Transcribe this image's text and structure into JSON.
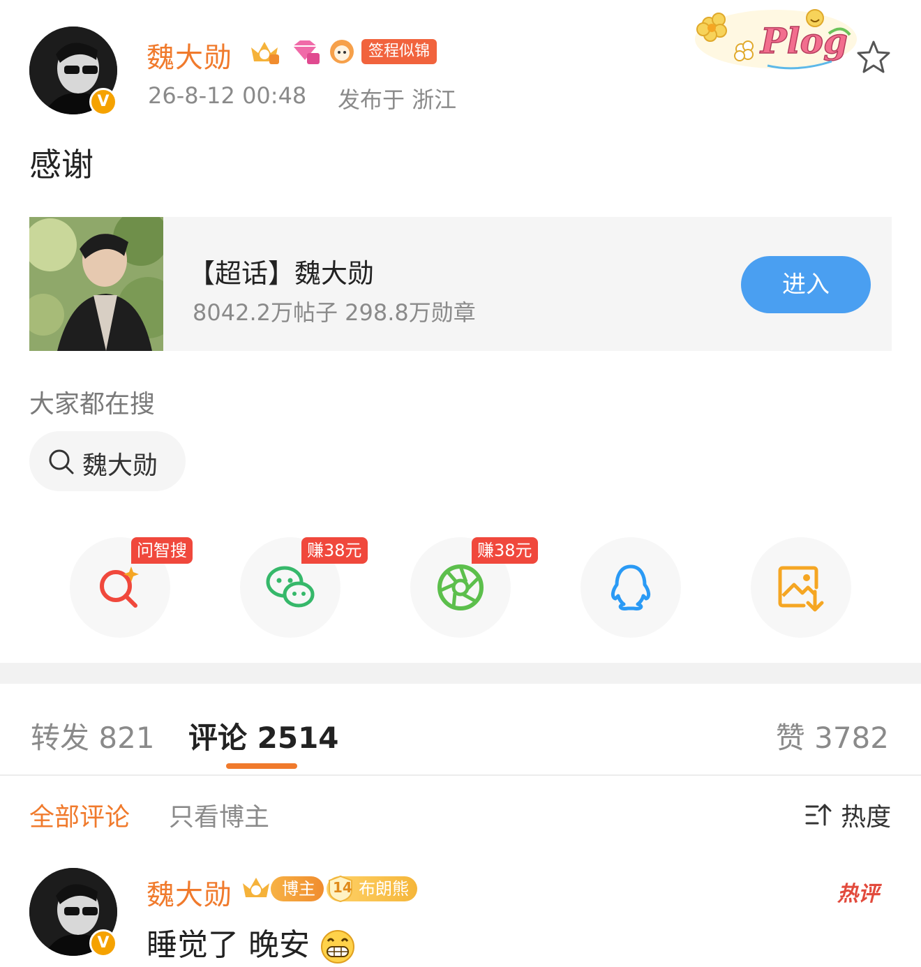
{
  "post": {
    "author": "魏大勋",
    "verified_badge": "V",
    "tag": "签程似锦",
    "time": "26-8-12 00:48",
    "location": "发布于 浙江",
    "text": "感谢",
    "decoration": "Plog"
  },
  "super_topic": {
    "title": "【超话】魏大勋",
    "stats": "8042.2万帖子 298.8万勋章",
    "enter_label": "进入"
  },
  "search": {
    "label": "大家都在搜",
    "chip": "魏大勋"
  },
  "share": {
    "items": [
      {
        "icon": "ai-search-icon",
        "tag": "问智搜",
        "color": "#f0483c"
      },
      {
        "icon": "wechat-icon",
        "tag": "赚38元",
        "color": "#36b86a"
      },
      {
        "icon": "moments-icon",
        "tag": "赚38元",
        "color": "#5cbf4c"
      },
      {
        "icon": "qq-icon",
        "tag": "",
        "color": "#2a9af5"
      },
      {
        "icon": "save-image-icon",
        "tag": "",
        "color": "#f5a623"
      }
    ]
  },
  "tabs": {
    "repost": {
      "label": "转发",
      "count": "821"
    },
    "comments": {
      "label": "评论",
      "count": "2514"
    },
    "likes": {
      "label": "赞",
      "count": "3782"
    }
  },
  "filters": {
    "all": "全部评论",
    "author_only": "只看博主",
    "sort": "热度"
  },
  "comment": {
    "author": "魏大勋",
    "host_badge": "博主",
    "fan_level": "14",
    "fan_badge": "布朗熊",
    "text": "睡觉了 晚安",
    "hot_label": "热评"
  },
  "colors": {
    "accent_orange": "#f07a2c",
    "enter_blue": "#4a9ff1",
    "tag_red": "#f1633d"
  }
}
